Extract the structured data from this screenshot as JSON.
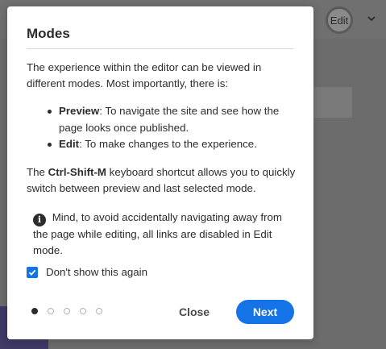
{
  "background": {
    "edit_button_label": "Edit"
  },
  "dialog": {
    "title": "Modes",
    "intro": "The experience within the editor can be viewed in different modes. Most importantly, there is:",
    "modes": [
      {
        "name": "Preview",
        "description": ": To navigate the site and see how the page looks once published."
      },
      {
        "name": "Edit",
        "description": ": To make changes to the experience."
      }
    ],
    "shortcut_prefix": "The ",
    "shortcut_key": "Ctrl-Shift-M",
    "shortcut_suffix": " keyboard shortcut allows you to quickly switch between preview and last selected mode.",
    "note": "Mind, to avoid accidentally navigating away from the page while editing, all links are disabled in Edit mode.",
    "checkbox_label": "Don't show this again",
    "checkbox_checked": true,
    "pager": {
      "total": 5,
      "current": 1
    },
    "close_label": "Close",
    "next_label": "Next"
  },
  "colors": {
    "accent": "#1473e6",
    "text": "#2c2c2c",
    "overlay": "#6e6e6e"
  },
  "icons": [
    "chevron-down-icon",
    "info-icon",
    "checkmark-icon"
  ]
}
